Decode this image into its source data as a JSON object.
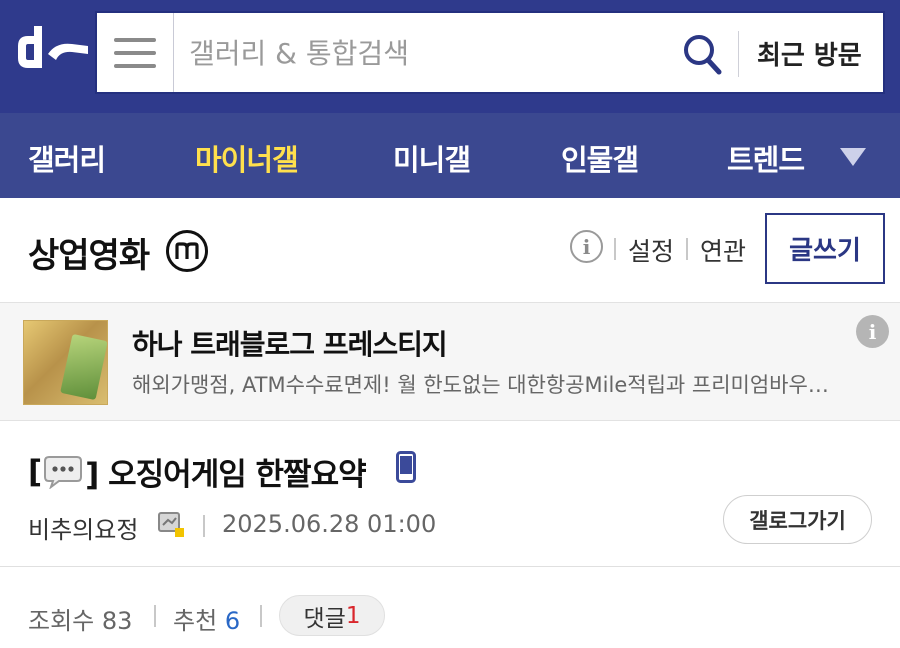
{
  "header": {
    "logo_name": "dc-logo",
    "search_placeholder": "갤러리 & 통합검색",
    "recent_label": "최근 방문",
    "colors": {
      "header_bg": "#2f3a8c",
      "nav_bg": "#3b4890",
      "active_nav": "#ffe04d"
    }
  },
  "nav": {
    "items": [
      {
        "label": "갤러리"
      },
      {
        "label": "마이너갤",
        "active": true
      },
      {
        "label": "미니갤"
      },
      {
        "label": "인물갤"
      },
      {
        "label": "트렌드"
      }
    ],
    "more_icon": "triangle-down-icon"
  },
  "gallery": {
    "title": "상업영화",
    "badge_icon": "minor-gallery-m-icon",
    "settings_label": "설정",
    "related_label": "연관",
    "write_label": "글쓰기"
  },
  "ad": {
    "title": "하나 트래블로그 프레스티지",
    "description": "해외가맹점, ATM수수료면제! 월 한도없는 대한항공Mile적립과 프리미엄바우…"
  },
  "post": {
    "title_prefix": "[",
    "title_suffix": "] 오징어게임 한짤요약",
    "author": "비추의요정",
    "date": "2025.06.28 01:00",
    "gallery_go_label": "갤로그가기"
  },
  "stats": {
    "views_label": "조회수",
    "views_value": "83",
    "recommend_label": "추천",
    "recommend_value": "6",
    "comment_label": "댓글",
    "comment_value": "1"
  }
}
